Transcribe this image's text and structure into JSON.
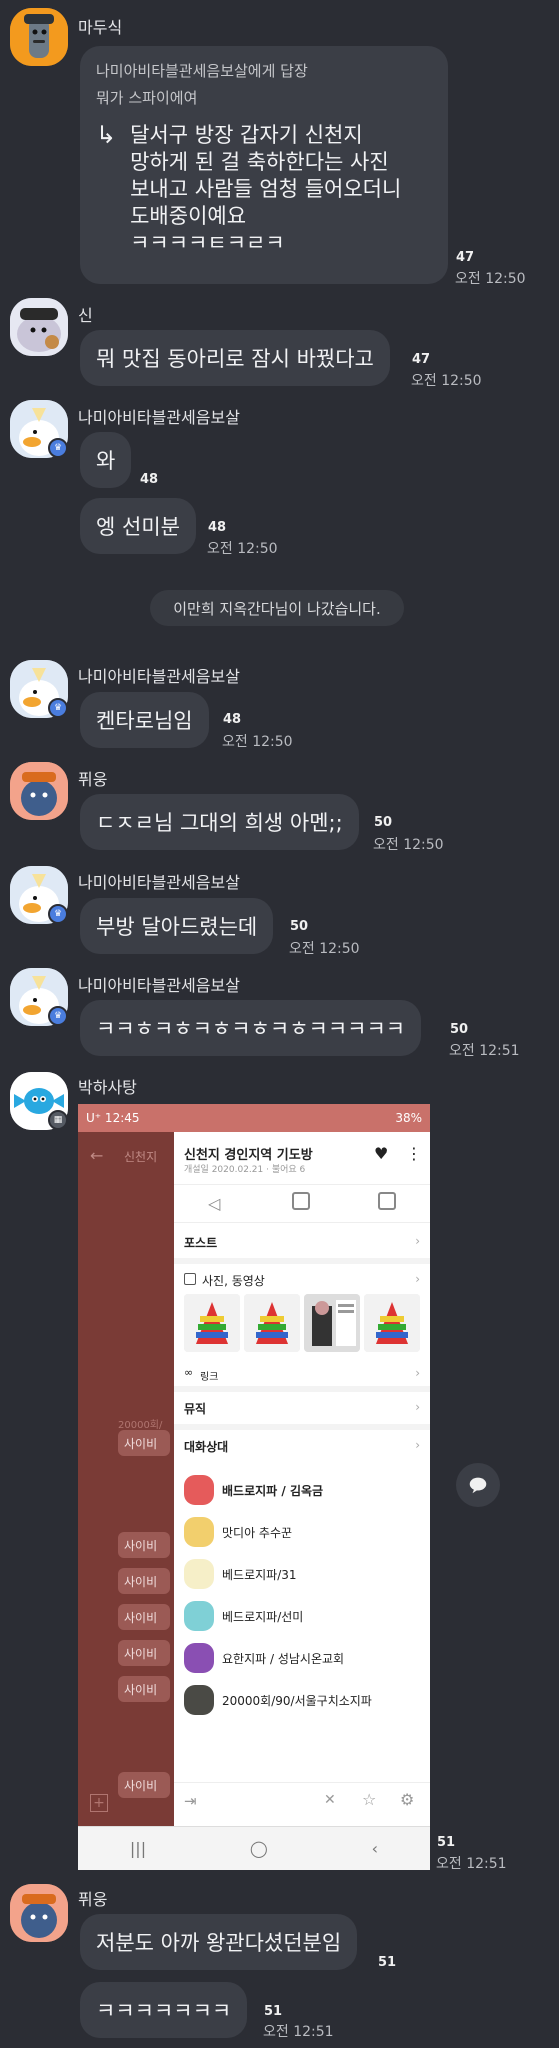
{
  "messages": {
    "m1": {
      "sender": "마두식",
      "quote_to": "나미아비타블관세음보살에게 답장",
      "quote_text": "뭐가 스파이에여",
      "reply_arrow": "↳",
      "lines": [
        "달서구 방장 갑자기 신천지",
        "망하게 된 걸 축하한다는 사진",
        "보내고 사람들 엄청 들어오더니",
        "도배중이예요",
        "ㅋㅋㅋㅋㅌㅋㄹㅋ"
      ],
      "count": "47",
      "time": "오전 12:50"
    },
    "m2": {
      "sender": "신",
      "text": "뭐 맛집 동아리로 잠시 바꿨다고",
      "count": "47",
      "time": "오전 12:50"
    },
    "m3": {
      "sender": "나미아비타블관세음보살",
      "text1": "와",
      "count1": "48",
      "text2": "엥 선미분",
      "count2": "48",
      "time": "오전 12:50"
    },
    "system": "이만희 지옥간다님이 나갔습니다.",
    "m4": {
      "sender": "나미아비타블관세음보살",
      "text": "켄타로님임",
      "count": "48",
      "time": "오전 12:50"
    },
    "m5": {
      "sender": "퓌웅",
      "text": "ㄷㅈㄹ님 그대의 희생 아멘;;",
      "count": "50",
      "time": "오전 12:50"
    },
    "m6": {
      "sender": "나미아비타블관세음보살",
      "text": "부방 달아드렸는데",
      "count": "50",
      "time": "오전 12:50"
    },
    "m7": {
      "sender": "나미아비타블관세음보살",
      "text": "ㅋㅋㅎㅋㅎㅋㅎㅋㅎㅋㅎㅋㅋㅋㅋㅋ",
      "count": "50",
      "time": "오전 12:51"
    },
    "m8": {
      "sender": "박하사탕",
      "count": "51",
      "time": "오전 12:51"
    },
    "m9": {
      "sender": "퓌웅",
      "text1": "저분도 아까 왕관다셨던분임",
      "count1": "51",
      "text2": "ㅋㅋㅋㅋㅋㅋㅋ",
      "count2": "51",
      "time": "오전 12:51"
    }
  },
  "screenshot": {
    "status_left": "U⁺ 12:45",
    "status_right": "38%",
    "room_title": "신천지 경인지역 기도방",
    "room_sub": "개설일 2020.02.21 · 불어요 6",
    "left_title": "신천지",
    "sections": {
      "post": "포스트",
      "photo": "사진, 동영상",
      "link": "링크",
      "music": "뮤직",
      "members": "대화상대"
    },
    "members": [
      "배드로지파 / 김옥금",
      "맛디아 추수꾼",
      "베드로지파/31",
      "베드로지파/선미",
      "요한지파 / 성남시온교회",
      "20000회/90/서울구치소지파"
    ],
    "left_pills": [
      "사이비",
      "사이비",
      "사이비",
      "사이비",
      "사이비",
      "사이비",
      "사이비"
    ],
    "left_count": "20000회/"
  },
  "colors": {
    "background": "#2b2d34",
    "bubble": "#3b3e46",
    "shot_header": "#c9716a"
  },
  "icons": [
    "reply-icon",
    "crown-icon",
    "heart-icon",
    "more-icon"
  ]
}
